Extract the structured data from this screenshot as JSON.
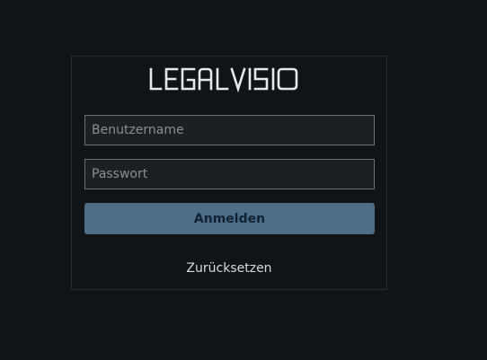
{
  "brand": {
    "logo_text": "LEGALVISIO",
    "logo_color": "#e6e8ea"
  },
  "form": {
    "username_placeholder": "Benutzername",
    "username_value": "",
    "password_placeholder": "Passwort",
    "password_value": "",
    "submit_label": "Anmelden",
    "reset_label": "Zurücksetzen"
  },
  "colors": {
    "background": "#111417",
    "card_border": "#2b2f34",
    "input_background": "#1c1f23",
    "button_background": "#4e6d87",
    "button_text": "#0f2233"
  }
}
